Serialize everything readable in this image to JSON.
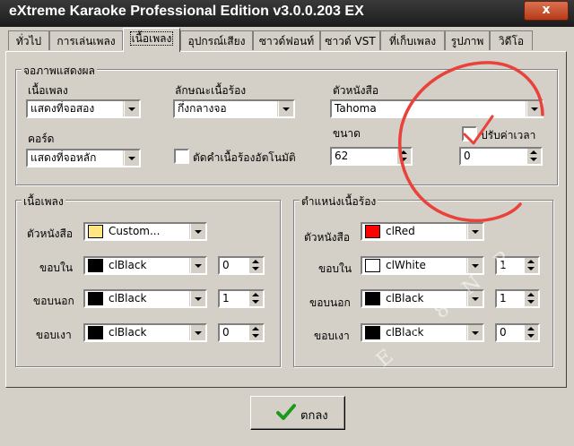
{
  "window": {
    "title": "eXtreme Karaoke Professional Edition v3.0.0.203 EX",
    "close_label": "x"
  },
  "tabs": [
    {
      "label": "ทั่วไป"
    },
    {
      "label": "การเล่นเพลง"
    },
    {
      "label": "เนื้อเพลง"
    },
    {
      "label": "อุปกรณ์เสียง"
    },
    {
      "label": "ซาวด์ฟอนท์"
    },
    {
      "label": "ซาวด์ VST"
    },
    {
      "label": "ที่เก็บเพลง"
    },
    {
      "label": "รูปภาพ"
    },
    {
      "label": "วิดีโอ"
    }
  ],
  "active_tab": "เนื้อเพลง",
  "display_group": {
    "title": "จอภาพแสดงผล",
    "lyrics_label": "เนื้อเพลง",
    "lyrics_value": "แสดงที่จอสอง",
    "chord_label": "คอร์ด",
    "chord_value": "แสดงที่จอหลัก",
    "style_label": "ลักษณะเนื้อร้อง",
    "style_value": "กึ่งกลางจอ",
    "autocut_label": "ตัดคำเนื้อร้องอัตโนมัติ",
    "font_label": "ตัวหนังสือ",
    "font_value": "Tahoma",
    "size_label": "ขนาด",
    "size_value": "62",
    "time_label": "ปรับค่าเวลา",
    "time_value": "0"
  },
  "lyrics_group": {
    "title": "เนื้อเพลง",
    "rows": [
      {
        "label": "ตัวหนังสือ",
        "color_name": "Custom...",
        "swatch": "#ffe680",
        "num": ""
      },
      {
        "label": "ขอบใน",
        "color_name": "clBlack",
        "swatch": "#000000",
        "num": "0"
      },
      {
        "label": "ขอบนอก",
        "color_name": "clBlack",
        "swatch": "#000000",
        "num": "1"
      },
      {
        "label": "ขอบเงา",
        "color_name": "clBlack",
        "swatch": "#000000",
        "num": "0"
      }
    ]
  },
  "position_group": {
    "title": "ตำแหน่งเนื้อร้อง",
    "rows": [
      {
        "label": "ตัวหนังสือ",
        "color_name": "clRed",
        "swatch": "#ff0000",
        "num": ""
      },
      {
        "label": "ขอบใน",
        "color_name": "clWhite",
        "swatch": "#ffffff",
        "num": "1"
      },
      {
        "label": "ขอบนอก",
        "color_name": "clBlack",
        "swatch": "#000000",
        "num": "1"
      },
      {
        "label": "ขอบเงา",
        "color_name": "clBlack",
        "swatch": "#000000",
        "num": "0"
      }
    ]
  },
  "ok_button": {
    "label": "ตกลง"
  },
  "annotation": {
    "color": "#e8423a"
  },
  "watermark": {
    "text": "E 2 8 N P"
  }
}
